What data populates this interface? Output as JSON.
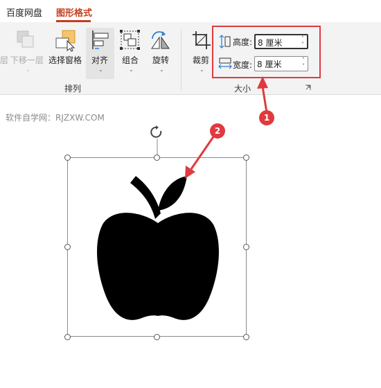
{
  "tabs": [
    {
      "label": "百度网盘"
    },
    {
      "label": "图形格式"
    }
  ],
  "ribbon": {
    "arrange": {
      "bring_forward_partial": "层",
      "send_backward": "下移一层",
      "selection_pane": "选择窗格",
      "align": "对齐",
      "group": "组合",
      "rotate": "旋转",
      "group_label": "排列"
    },
    "size": {
      "crop": "裁剪",
      "height_label": "高度:",
      "height_value": "8 厘米",
      "width_label": "宽度:",
      "width_value": "8 厘米",
      "group_label": "大小"
    }
  },
  "watermark": "软件自学网：RJZXW.COM",
  "annotations": [
    {
      "number": "1"
    },
    {
      "number": "2"
    }
  ],
  "colors": {
    "accent": "#c43e1c",
    "highlight": "#e0393e",
    "shape_fill": "#000000"
  }
}
